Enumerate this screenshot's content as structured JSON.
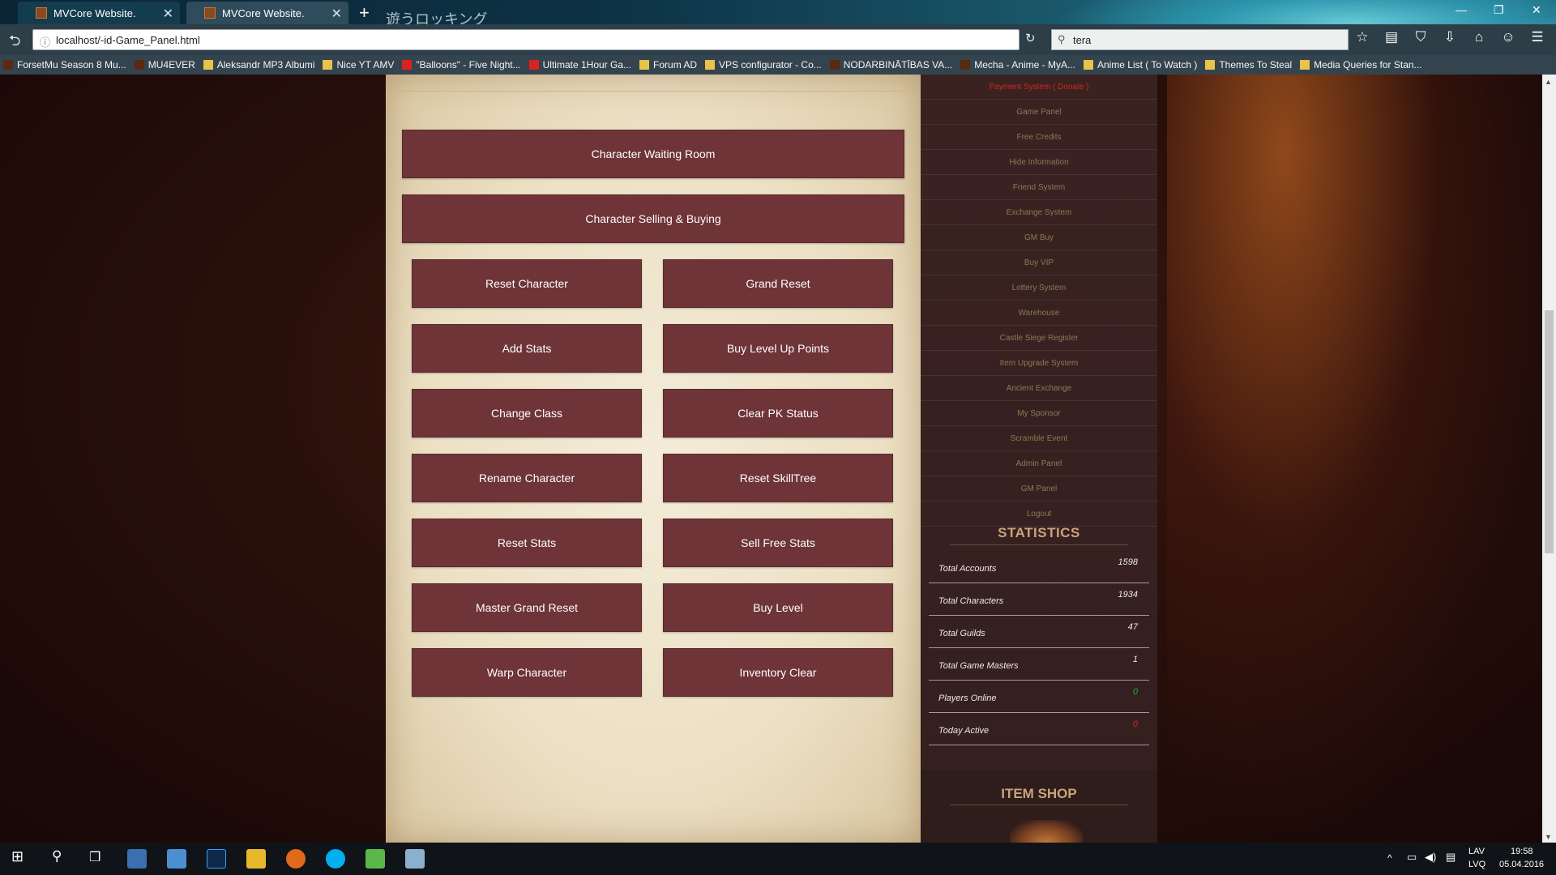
{
  "browser": {
    "tabs": [
      {
        "title": "MVCore Website."
      },
      {
        "title": "MVCore Website."
      }
    ],
    "tab_overlay_text": "遊うロッキング",
    "url": "localhost/-id-Game_Panel.html",
    "search_value": "tera",
    "bookmarks": [
      "ForsetMu Season 8 Mu...",
      "MU4EVER",
      "Aleksandr MP3 Albumi",
      "Nice YT AMV",
      "\"Balloons\" - Five Night...",
      "Ultimate 1Hour Ga...",
      "Forum AD",
      "VPS configurator - Co...",
      "NODARBINĀTĪBAS VA...",
      "Mecha - Anime - MyA...",
      "Anime List ( To Watch )",
      "Themes To Steal",
      "Media Queries for Stan..."
    ]
  },
  "panel": {
    "wide_buttons": [
      "Character Waiting Room",
      "Character Selling & Buying"
    ],
    "button_pairs": [
      [
        "Reset Character",
        "Grand Reset"
      ],
      [
        "Add Stats",
        "Buy Level Up Points"
      ],
      [
        "Change Class",
        "Clear PK Status"
      ],
      [
        "Rename Character",
        "Reset SkillTree"
      ],
      [
        "Reset Stats",
        "Sell Free Stats"
      ],
      [
        "Master Grand Reset",
        "Buy Level"
      ],
      [
        "Warp Character",
        "Inventory Clear"
      ]
    ]
  },
  "sidebar": {
    "menu": [
      "Payment System ( Donate )",
      "Game Panel",
      "Free Credits",
      "Hide Information",
      "Friend System",
      "Exchange System",
      "GM Buy",
      "Buy VIP",
      "Lottery System",
      "Warehouse",
      "Castle Siege Register",
      "Item Upgrade System",
      "Ancient Exchange",
      "My Sponsor",
      "Scramble Event",
      "Admin Panel",
      "GM Panel",
      "Logout"
    ],
    "statistics_title": "STATISTICS",
    "statistics": [
      {
        "label": "Total Accounts",
        "value": "1598"
      },
      {
        "label": "Total Characters",
        "value": "1934"
      },
      {
        "label": "Total Guilds",
        "value": "47"
      },
      {
        "label": "Total Game Masters",
        "value": "1"
      },
      {
        "label": "Players Online",
        "value": "0"
      },
      {
        "label": "Today Active",
        "value": "0"
      }
    ],
    "item_shop_title": "ITEM SHOP"
  },
  "taskbar": {
    "lang": "LAV",
    "lang2": "LVQ",
    "time": "19:58",
    "date": "05.04.2016"
  },
  "colors": {
    "button": "#6e3438",
    "menu_text": "#8a7a56",
    "highlight": "#d12a1a",
    "online_value": "#2ea82e"
  }
}
